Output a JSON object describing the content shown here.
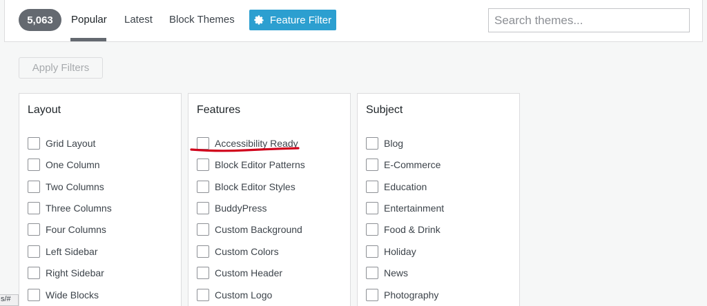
{
  "header": {
    "theme_count": "5,063",
    "tabs": [
      {
        "label": "Popular",
        "active": true
      },
      {
        "label": "Latest",
        "active": false
      },
      {
        "label": "Block Themes",
        "active": false
      }
    ],
    "feature_filter_label": "Feature Filter",
    "search_placeholder": "Search themes..."
  },
  "apply_filters_label": "Apply Filters",
  "panels": [
    {
      "title": "Layout",
      "options": [
        "Grid Layout",
        "One Column",
        "Two Columns",
        "Three Columns",
        "Four Columns",
        "Left Sidebar",
        "Right Sidebar",
        "Wide Blocks"
      ]
    },
    {
      "title": "Features",
      "options": [
        "Accessibility Ready",
        "Block Editor Patterns",
        "Block Editor Styles",
        "BuddyPress",
        "Custom Background",
        "Custom Colors",
        "Custom Header",
        "Custom Logo"
      ]
    },
    {
      "title": "Subject",
      "options": [
        "Blog",
        "E-Commerce",
        "Education",
        "Entertainment",
        "Food & Drink",
        "Holiday",
        "News",
        "Photography"
      ]
    }
  ],
  "status_bar_url": "s/#",
  "colors": {
    "accent": "#2c9fd0",
    "annotation": "#d0021b",
    "badge": "#646970"
  }
}
